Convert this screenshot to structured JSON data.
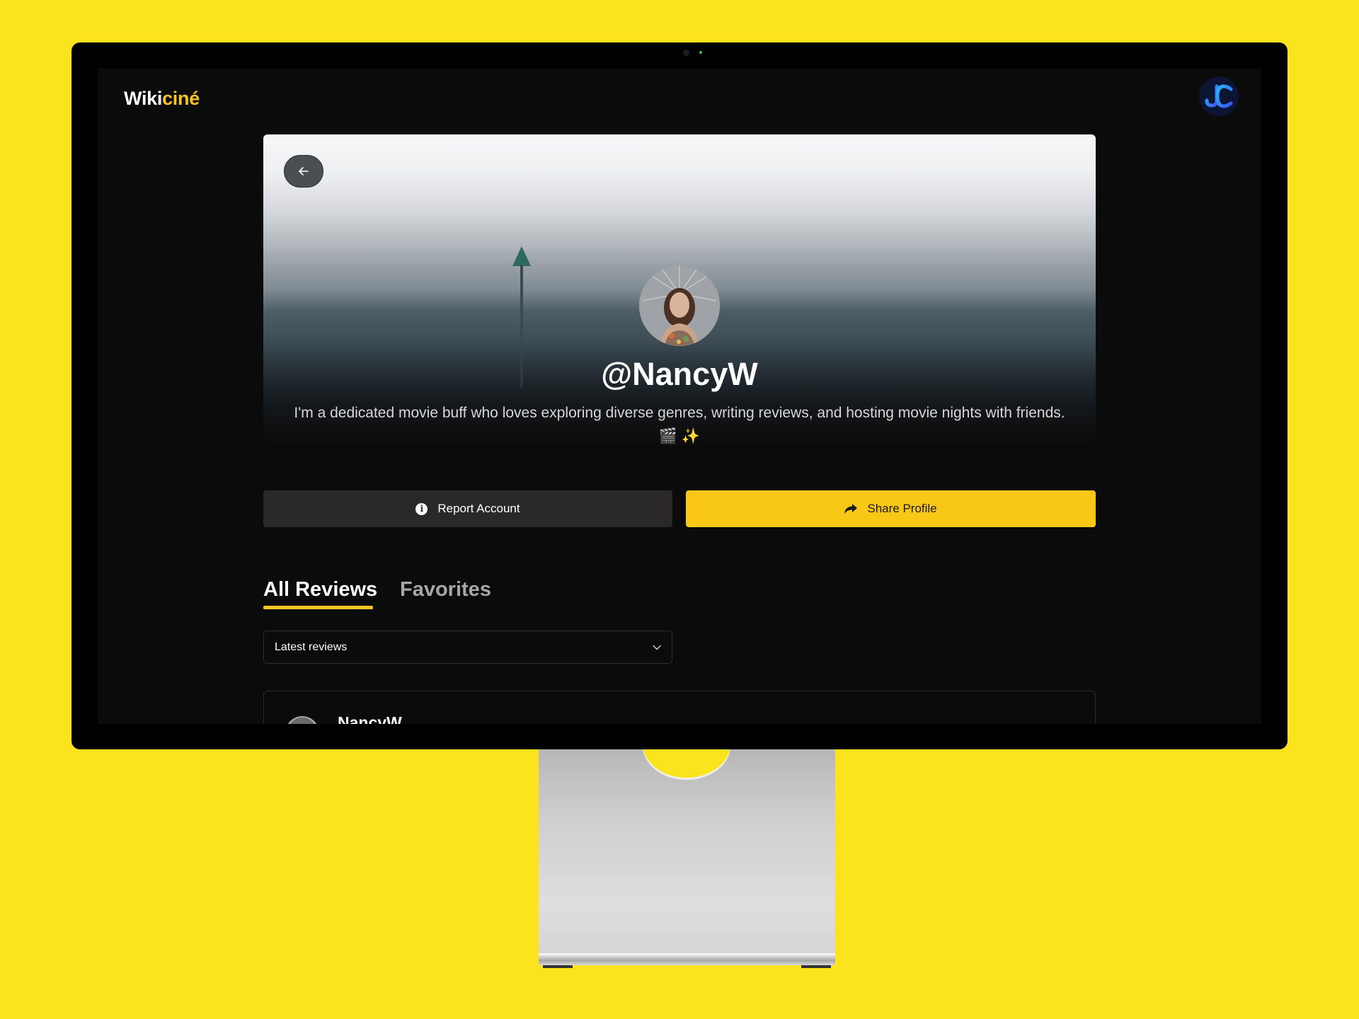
{
  "brand": {
    "name_main": "Wiki",
    "name_accent": "ciné",
    "accent_color": "#f7c51e"
  },
  "user_menu": {
    "avatar_initials": "JC"
  },
  "profile": {
    "username": "@NancyW",
    "bio": "I'm a dedicated movie buff who loves exploring diverse genres, writing reviews, and hosting movie nights with friends. 🎬 ✨"
  },
  "actions": {
    "report_label": "Report Account",
    "share_label": "Share Profile"
  },
  "tabs": [
    {
      "label": "All Reviews",
      "active": true
    },
    {
      "label": "Favorites",
      "active": false
    }
  ],
  "sort": {
    "selected": "Latest reviews"
  },
  "reviews": [
    {
      "username": "NancyW"
    }
  ],
  "icons": {
    "back": "arrow-left-icon",
    "report": "info-icon",
    "share": "share-arrow-icon",
    "dropdown": "chevron-down-icon"
  }
}
